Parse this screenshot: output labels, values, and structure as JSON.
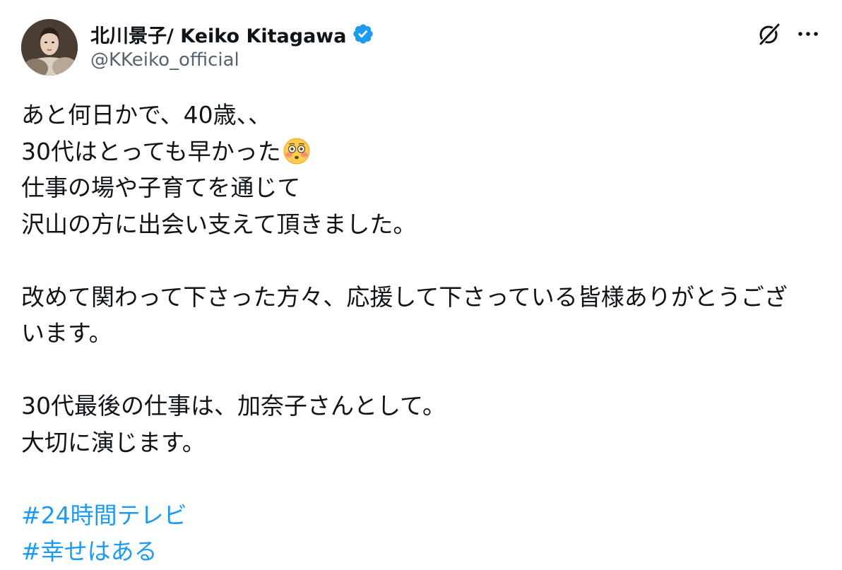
{
  "author": {
    "display_name": "北川景子/ Keiko Kitagawa",
    "handle": "@KKeiko_official",
    "verified_color": "#1d9bf0"
  },
  "actions": {
    "grok_icon": "grok-icon",
    "more_icon": "more-icon",
    "more_label": "···"
  },
  "post": {
    "lines": [
      "あと何日かで、40歳、、",
      "30代はとっても早かった",
      "仕事の場や子育てを通じて",
      "沢山の方に出会い支えて頂きました。",
      "",
      "改めて関わって下さった方々、応援して下さっている皆様ありがとうござ",
      "います。",
      "",
      "30代最後の仕事は、加奈子さんとして。",
      "大切に演じます。",
      ""
    ],
    "emoji": "flushed-face-emoji",
    "hashtags": [
      "#24時間テレビ",
      "#幸せはある"
    ],
    "hashtag_color": "#1d9bf0"
  }
}
